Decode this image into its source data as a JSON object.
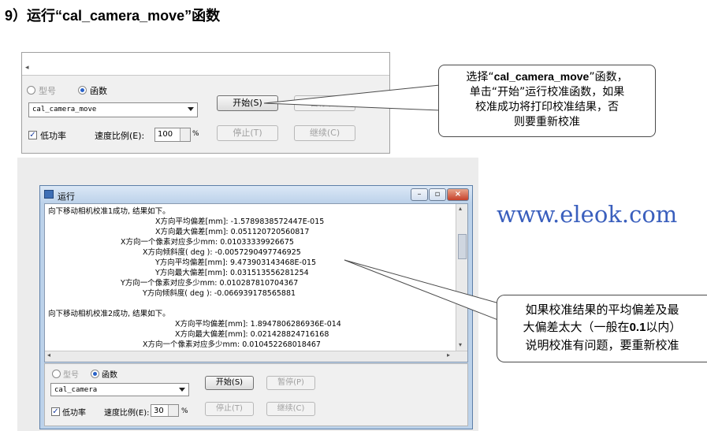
{
  "heading": "9）运行“cal_camera_move”函数",
  "top_panel": {
    "radio_model": "型号",
    "radio_function": "函数",
    "function_select": "cal_camera_move",
    "btn_start": "开始(S)",
    "btn_pause": "暂停(P)",
    "btn_stop": "停止(T)",
    "btn_continue": "继续(C)",
    "low_power": "低功率",
    "speed_label": "速度比例(E):",
    "speed_value": "100",
    "unit": "%"
  },
  "callout_top": {
    "line1_prefix": "选择“",
    "line1_bold": "cal_camera_move",
    "line1_suffix": "”函数，",
    "line2": "单击“开始”运行校准函数，如果",
    "line3": "校准成功将打印校准结果，否",
    "line4": "则要重新校准"
  },
  "run_window": {
    "title": "运行",
    "log_lines": [
      "向下移动相机校准1成功, 结果如下。",
      "X方向平均偏差[mm]: -1.5789838572447E-015",
      "X方向最大偏差[mm]: 0.051120720560817",
      "X方向一个像素对应多少mm: 0.01033339926675",
      "X方向倾斜度( deg ): -0.0057290497746925",
      "Y方向平均偏差[mm]: 9.473903143468E-015",
      "Y方向最大偏差[mm]: 0.031513556281254",
      "Y方向一个像素对应多少mm: 0.010287810704367",
      "Y方向倾斜度( deg ): -0.066939178565881",
      "向下移动相机校准2成功, 结果如下。",
      "X方向平均偏差[mm]: 1.8947806286936E-014",
      "X方向最大偏差[mm]: 0.021428824716168",
      "X方向一个像素对应多少mm: 0.010452268018467"
    ],
    "radio_model": "型号",
    "radio_function": "函数",
    "function_select": "cal_camera",
    "btn_start": "开始(S)",
    "btn_pause": "暂停(P)",
    "btn_stop": "停止(T)",
    "btn_continue": "继续(C)",
    "low_power": "低功率",
    "speed_label": "速度比例(E):",
    "speed_value": "30",
    "unit": "%"
  },
  "watermark": "www.eleok.com",
  "callout_bottom": {
    "line1": "如果校准结果的平均偏差及最",
    "line2_prefix": "大偏差太大（一般在",
    "line2_bold": "0.1",
    "line2_suffix": "以内）",
    "line3": "说明校准有问题，要重新校准"
  },
  "colors": {
    "accent": "#3a5fbd",
    "titlebar": "#bcd2ea",
    "close": "#c6402a"
  }
}
